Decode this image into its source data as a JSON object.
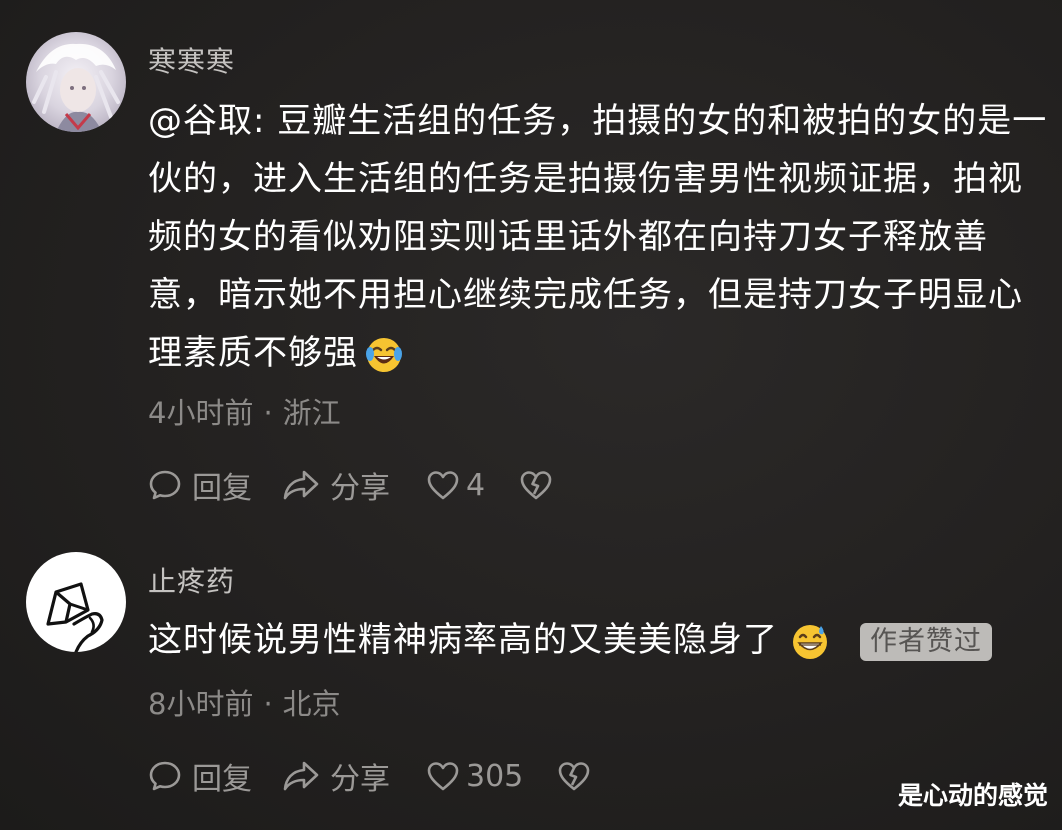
{
  "comments": [
    {
      "username": "寒寒寒",
      "lines": [
        "@谷取: 豆瓣生活组的任务，拍摄的女的和被拍的女的是一",
        "伙的，进入生活组的任务是拍摄伤害男性视频证据，拍视",
        "频的女的看似劝阻实则话里话外都在向持刀女子释放善",
        "意，暗示她不用担心继续完成任务，但是持刀女子明显心",
        "理素质不够强"
      ],
      "emoji": "laughing-crying-emoji",
      "time": "4小时前",
      "dot": "·",
      "location": "浙江",
      "reply_label": "回复",
      "share_label": "分享",
      "like_count": "4"
    },
    {
      "username": "止疼药",
      "lines": [
        "这时候说男性精神病率高的又美美隐身了"
      ],
      "emoji": "grinning-sweat-emoji",
      "badge": "作者赞过",
      "time": "8小时前",
      "dot": "·",
      "location": "北京",
      "reply_label": "回复",
      "share_label": "分享",
      "like_count": "305"
    }
  ],
  "watermark": "是心动的感觉",
  "colors": {
    "background": "#232120",
    "text_primary": "#ffffff",
    "text_secondary": "#8c8a88",
    "badge_bg": "#bdbbb8"
  }
}
